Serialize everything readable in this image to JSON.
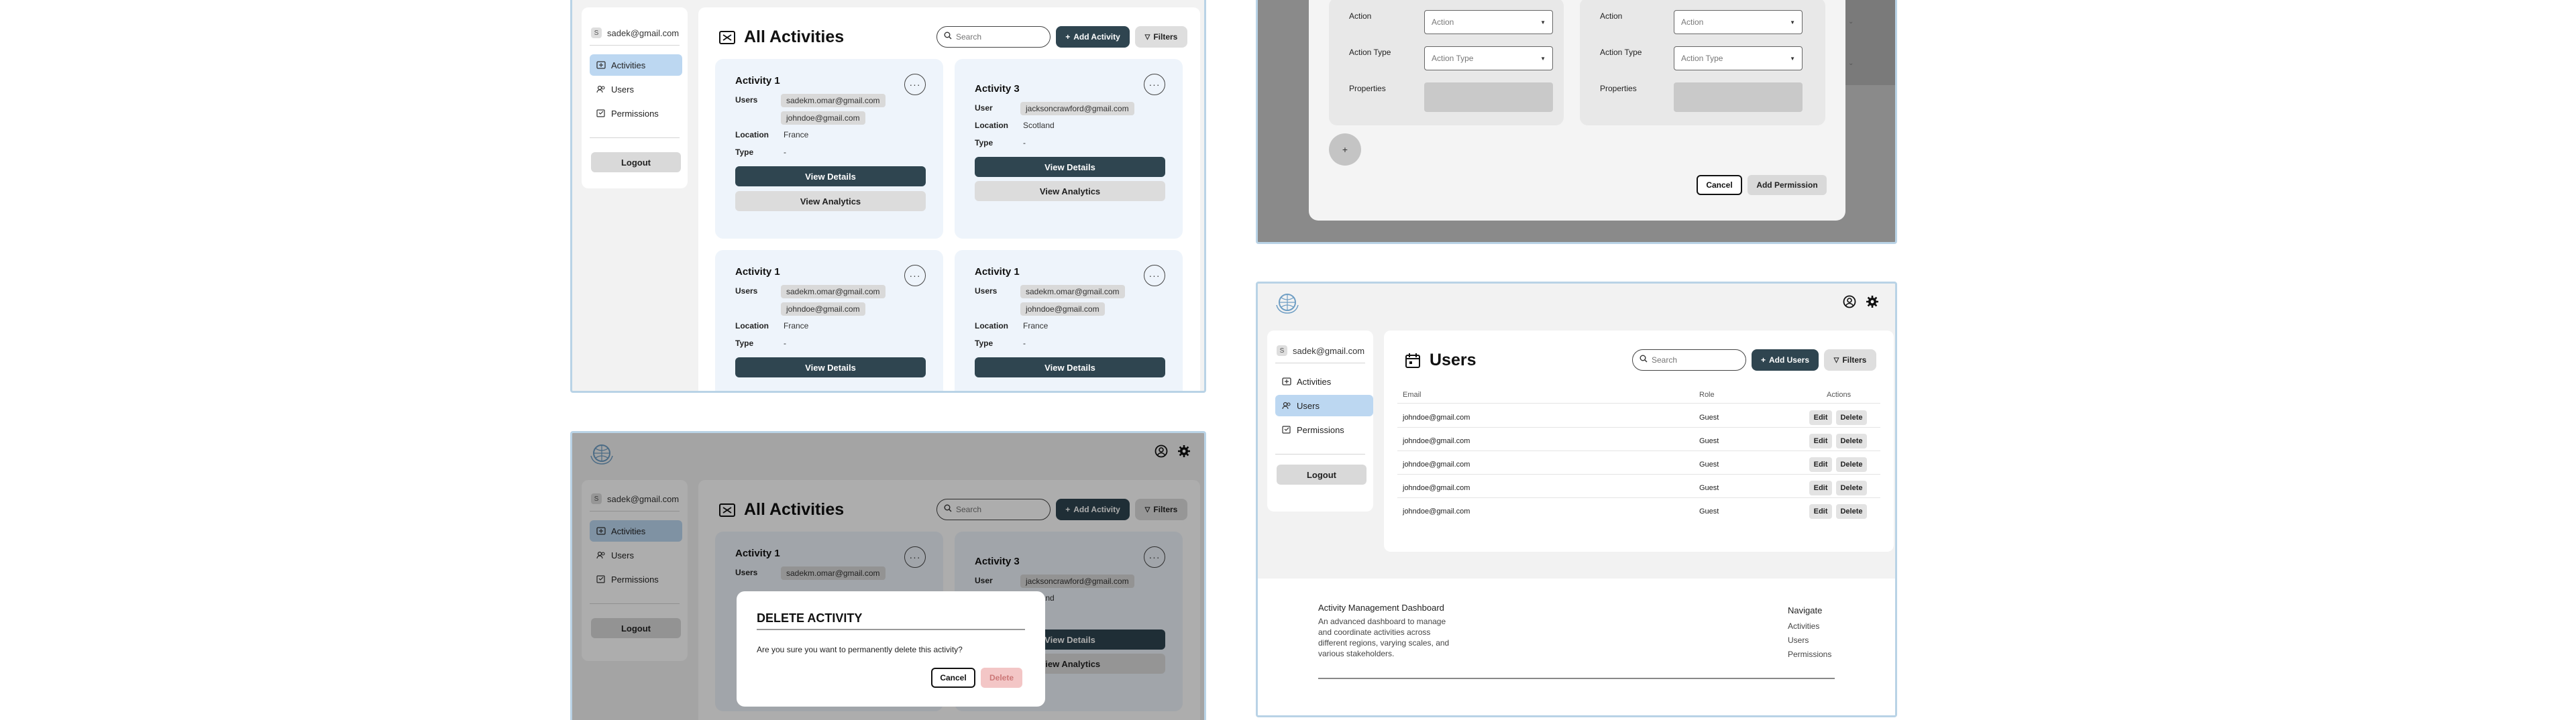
{
  "account": {
    "email": "sadek@gmail.com",
    "avatar_letter": "S"
  },
  "nav": {
    "activities": "Activities",
    "users": "Users",
    "permissions": "Permissions",
    "logout": "Logout"
  },
  "activities_page": {
    "title": "All Activities",
    "search_placeholder": "Search",
    "add_button": "Add Activity",
    "filters_button": "Filters",
    "view_details": "View Details",
    "view_analytics": "View Analytics",
    "labels": {
      "users": "Users",
      "user": "User",
      "location": "Location",
      "type": "Type"
    },
    "cards": [
      {
        "title": "Activity 1",
        "users": [
          "sadekm.omar@gmail.com",
          "johndoe@gmail.com"
        ],
        "location": "France",
        "type": "-"
      },
      {
        "title": "Activity 3",
        "user": "jacksoncrawford@gmail.com",
        "location": "Scotland",
        "type": "-"
      },
      {
        "title": "Activity 1",
        "users": [
          "sadekm.omar@gmail.com",
          "johndoe@gmail.com"
        ],
        "location": "France",
        "type": "-"
      },
      {
        "title": "Activity 1",
        "users": [
          "sadekm.omar@gmail.com",
          "johndoe@gmail.com"
        ],
        "location": "France",
        "type": "-"
      }
    ]
  },
  "delete_modal": {
    "title": "DELETE ACTIVITY",
    "message": "Are you sure you want to permanently delete this activity?",
    "cancel": "Cancel",
    "delete": "Delete"
  },
  "permission_form": {
    "action_label": "Action",
    "action_placeholder": "Action",
    "action_type_label": "Action Type",
    "action_type_placeholder": "Action Type",
    "properties_label": "Properties",
    "add_symbol": "+",
    "cancel": "Cancel",
    "submit": "Add Permission"
  },
  "users_page": {
    "title": "Users",
    "search_placeholder": "Search",
    "add_button": "Add Users",
    "filters_button": "Filters",
    "columns": {
      "email": "Email",
      "role": "Role",
      "actions": "Actions"
    },
    "edit": "Edit",
    "delete": "Delete",
    "rows": [
      {
        "email": "johndoe@gmail.com",
        "role": "Guest"
      },
      {
        "email": "johndoe@gmail.com",
        "role": "Guest"
      },
      {
        "email": "johndoe@gmail.com",
        "role": "Guest"
      },
      {
        "email": "johndoe@gmail.com",
        "role": "Guest"
      },
      {
        "email": "johndoe@gmail.com",
        "role": "Guest"
      }
    ]
  },
  "footer": {
    "title": "Activity Management Dashboard",
    "description": "An advanced dashboard to manage and coordinate activities across different regions, varying scales, and various stakeholders.",
    "nav_title": "Navigate",
    "links": [
      "Activities",
      "Users",
      "Permissions"
    ]
  },
  "colors": {
    "primary_dark": "#2f4550",
    "active_nav": "#bcd7f1",
    "card_bg": "#eef4fb",
    "frame_border": "#b9d3e6",
    "danger": "#f3c6c6"
  }
}
